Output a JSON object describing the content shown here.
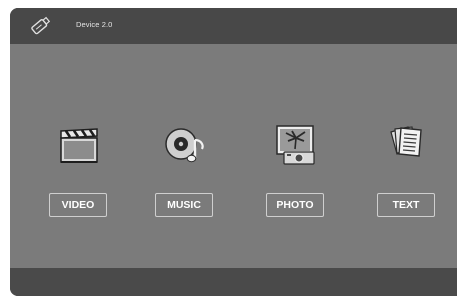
{
  "header": {
    "device_label": "Device 2.0",
    "icon": "usb-drive-icon"
  },
  "menu": [
    {
      "label": "VIDEO",
      "icon": "clapperboard-icon"
    },
    {
      "label": "MUSIC",
      "icon": "music-disc-icon"
    },
    {
      "label": "PHOTO",
      "icon": "photo-camera-icon"
    },
    {
      "label": "TEXT",
      "icon": "document-icon"
    }
  ],
  "colors": {
    "header": "#484848",
    "content": "#7b7b7b",
    "footer": "#4a4a4a"
  }
}
